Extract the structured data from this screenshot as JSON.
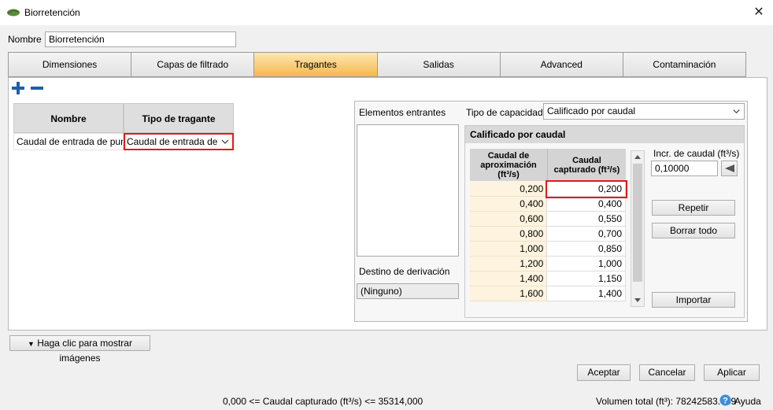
{
  "window": {
    "title": "Biorretención"
  },
  "name_field": {
    "label": "Nombre",
    "value": "Biorretención"
  },
  "tabs": [
    {
      "label": "Dimensiones"
    },
    {
      "label": "Capas de filtrado"
    },
    {
      "label": "Tragantes",
      "active": true
    },
    {
      "label": "Salidas"
    },
    {
      "label": "Advanced"
    },
    {
      "label": "Contaminación"
    }
  ],
  "inlet_grid": {
    "headers": {
      "name": "Nombre",
      "type": "Tipo de tragante"
    },
    "rows": [
      {
        "name": "Caudal de entrada de punto",
        "type": "Caudal de entrada de punto"
      }
    ]
  },
  "right_panel": {
    "incoming_label": "Elementos entrantes",
    "capacity_type_label": "Tipo de capacidad",
    "capacity_type_value": "Calificado por caudal",
    "bypass_label": "Destino de derivación",
    "bypass_value": "(Ninguno)",
    "rated_section": {
      "title": "Calificado por caudal",
      "col1_header": "Caudal de aproximación (ft³/s)",
      "col2_header": "Caudal capturado (ft³/s)",
      "rows": [
        {
          "approach": "0,200",
          "captured": "0,200"
        },
        {
          "approach": "0,400",
          "captured": "0,400"
        },
        {
          "approach": "0,600",
          "captured": "0,550"
        },
        {
          "approach": "0,800",
          "captured": "0,700"
        },
        {
          "approach": "1,000",
          "captured": "0,850"
        },
        {
          "approach": "1,200",
          "captured": "1,000"
        },
        {
          "approach": "1,400",
          "captured": "1,150"
        },
        {
          "approach": "1,600",
          "captured": "1,400"
        }
      ],
      "increment_label": "Incr. de caudal (ft³/s)",
      "increment_value": "0,10000",
      "repeat_button": "Repetir",
      "clear_button": "Borrar todo",
      "import_button": "Importar"
    }
  },
  "show_images_button": "Haga clic para mostrar imágenes",
  "footer_buttons": {
    "accept": "Aceptar",
    "cancel": "Cancelar",
    "apply": "Aplicar"
  },
  "status": {
    "range_text": "0,000 <= Caudal capturado (ft³/s) <= 35314,000",
    "volume_text": "Volumen total (ft³): 78242583.789",
    "help_label": "Ayuda"
  },
  "colors": {
    "active_tab": "#f6b84b",
    "error_border": "#e21b1b",
    "help_icon": "#3b8fd9"
  }
}
